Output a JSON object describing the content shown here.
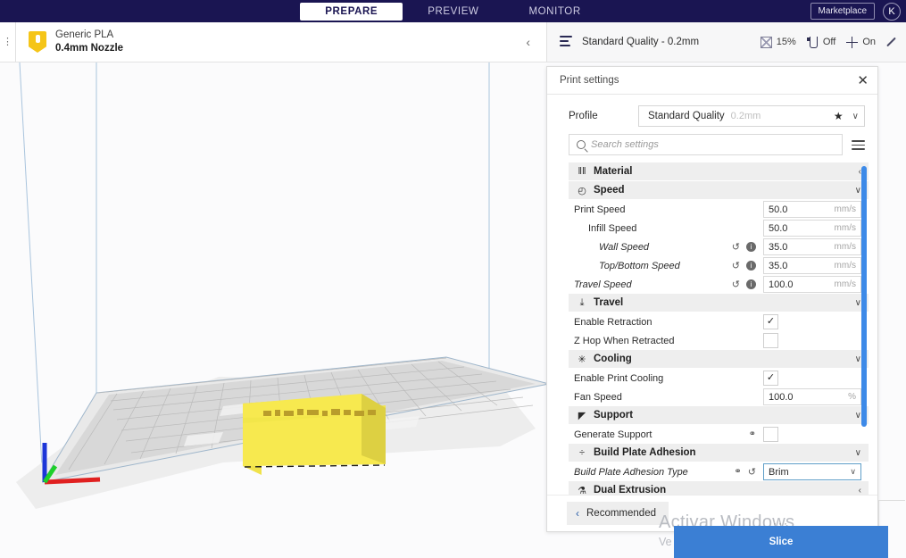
{
  "app": {
    "stage_tabs": [
      {
        "label": "PREPARE",
        "active": true
      },
      {
        "label": "PREVIEW",
        "active": false
      },
      {
        "label": "MONITOR",
        "active": false
      }
    ],
    "marketplace_label": "Marketplace",
    "avatar_initial": "K"
  },
  "config_bar": {
    "material_name": "Generic PLA",
    "material_nozzle": "0.4mm Nozzle",
    "collapse_chevron": "‹",
    "quality_name": "Standard Quality - 0.2mm",
    "infill_value": "15%",
    "support_value": "Off",
    "adhesion_value": "On"
  },
  "print_settings": {
    "title": "Print settings",
    "close_label": "✕",
    "profile_label": "Profile",
    "profile_value": "Standard Quality",
    "profile_variant": "0.2mm",
    "star_glyph": "★",
    "chevron_down": "∨",
    "search_placeholder": "Search settings",
    "recommended_label": "Recommended",
    "recommended_chevron": "‹",
    "rows": [
      {
        "kind": "category",
        "name": "material",
        "icon": "‖‖",
        "label": "Material",
        "chevron": "‹"
      },
      {
        "kind": "category",
        "name": "speed",
        "icon": "◴",
        "label": "Speed",
        "chevron": "∨"
      },
      {
        "kind": "setting",
        "name": "print-speed",
        "label": "Print Speed",
        "indent": 0,
        "italic": false,
        "control": "text",
        "value": "50.0",
        "unit": "mm/s",
        "revert": false,
        "info": false,
        "link": false
      },
      {
        "kind": "setting",
        "name": "infill-speed",
        "label": "Infill Speed",
        "indent": 1,
        "italic": false,
        "control": "text",
        "value": "50.0",
        "unit": "mm/s",
        "revert": false,
        "info": false,
        "link": false
      },
      {
        "kind": "setting",
        "name": "wall-speed",
        "label": "Wall Speed",
        "indent": 2,
        "italic": true,
        "control": "text",
        "value": "35.0",
        "unit": "mm/s",
        "revert": true,
        "info": true,
        "link": false
      },
      {
        "kind": "setting",
        "name": "top-bottom-speed",
        "label": "Top/Bottom Speed",
        "indent": 2,
        "italic": true,
        "control": "text",
        "value": "35.0",
        "unit": "mm/s",
        "revert": true,
        "info": true,
        "link": false
      },
      {
        "kind": "setting",
        "name": "travel-speed",
        "label": "Travel Speed",
        "indent": 0,
        "italic": true,
        "control": "text",
        "value": "100.0",
        "unit": "mm/s",
        "revert": true,
        "info": true,
        "link": false
      },
      {
        "kind": "category",
        "name": "travel",
        "icon": "⤓",
        "label": "Travel",
        "chevron": "∨"
      },
      {
        "kind": "setting",
        "name": "enable-retraction",
        "label": "Enable Retraction",
        "indent": 0,
        "italic": false,
        "control": "checkbox",
        "checked": true,
        "revert": false,
        "info": false,
        "link": false
      },
      {
        "kind": "setting",
        "name": "z-hop-when-retracted",
        "label": "Z Hop When Retracted",
        "indent": 0,
        "italic": false,
        "control": "checkbox",
        "checked": false,
        "revert": false,
        "info": false,
        "link": false
      },
      {
        "kind": "category",
        "name": "cooling",
        "icon": "✳",
        "label": "Cooling",
        "chevron": "∨"
      },
      {
        "kind": "setting",
        "name": "enable-print-cooling",
        "label": "Enable Print Cooling",
        "indent": 0,
        "italic": false,
        "control": "checkbox",
        "checked": true,
        "revert": false,
        "info": false,
        "link": false
      },
      {
        "kind": "setting",
        "name": "fan-speed",
        "label": "Fan Speed",
        "indent": 0,
        "italic": false,
        "control": "text",
        "value": "100.0",
        "unit": "%",
        "revert": false,
        "info": false,
        "link": false
      },
      {
        "kind": "category",
        "name": "support",
        "icon": "◤",
        "label": "Support",
        "chevron": "∨"
      },
      {
        "kind": "setting",
        "name": "generate-support",
        "label": "Generate Support",
        "indent": 0,
        "italic": false,
        "control": "checkbox",
        "checked": false,
        "revert": false,
        "info": false,
        "link": true
      },
      {
        "kind": "category",
        "name": "build-plate-adhesion",
        "icon": "÷",
        "label": "Build Plate Adhesion",
        "chevron": "∨"
      },
      {
        "kind": "setting",
        "name": "build-plate-adhesion-type",
        "label": "Build Plate Adhesion Type",
        "indent": 0,
        "italic": true,
        "control": "dropdown",
        "value": "Brim",
        "revert": true,
        "info": false,
        "link": true,
        "focused": true
      },
      {
        "kind": "category",
        "name": "dual-extrusion",
        "icon": "⚗",
        "label": "Dual Extrusion",
        "chevron": "‹"
      }
    ]
  },
  "action": {
    "slice_label": "Slice",
    "grip_glyph": "···"
  },
  "watermark": {
    "title": "Activar Windows",
    "subtitle": "Ve a Configuración para activar Windows."
  },
  "colors": {
    "topbar": "#1a1552",
    "accent_blue": "#3b7fd4",
    "scrollbar_blue": "#3d8ae8",
    "material_yellow": "#f5c518",
    "model_yellow": "#f2e64a"
  }
}
